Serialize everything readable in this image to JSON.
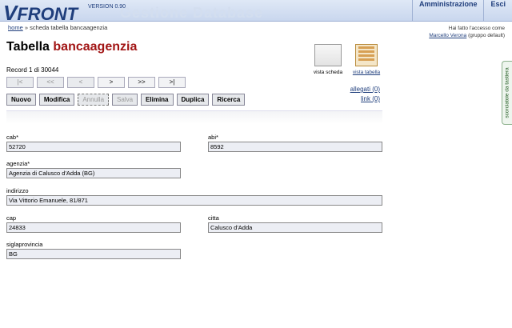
{
  "header": {
    "logo_v": "V",
    "logo_rest": "FRONT",
    "version": "VERSION 0.90",
    "ghost": "Gestione Database",
    "nav": [
      "Amministrazione",
      "Esci"
    ]
  },
  "breadcrumb": {
    "home": "home",
    "rest": "» scheda tabella bancaagenzia"
  },
  "login": {
    "line1": "Hai fatto l'accesso come",
    "user": "Marcello Verona",
    "group": "(gruppo default)"
  },
  "title": {
    "prefix": "Tabella",
    "table": "bancaagenzia"
  },
  "record": "Record 1 di 30044",
  "nav_buttons": [
    "|<",
    "<<",
    "<",
    ">",
    ">>",
    ">|"
  ],
  "action_buttons": [
    "Nuovo",
    "Modifica",
    "Annulla",
    "Salva",
    "Elimina",
    "Duplica",
    "Ricerca"
  ],
  "views": {
    "scheda": "vista scheda",
    "tabella": "vista tabella"
  },
  "links": {
    "allegati": "allegati (0)",
    "link": "link (0)"
  },
  "side_tab": "scorciatoie da tastiera",
  "fields": {
    "cab": {
      "label": "cab*",
      "value": "52720"
    },
    "abi": {
      "label": "abi*",
      "value": "8592"
    },
    "agenzia": {
      "label": "agenzia*",
      "value": "Agenzia di Calusco d'Adda (BG)"
    },
    "indirizzo": {
      "label": "indirizzo",
      "value": "Via Vittorio Emanuele, 81/871"
    },
    "cap": {
      "label": "cap",
      "value": "24833"
    },
    "citta": {
      "label": "citta",
      "value": "Calusco d'Adda"
    },
    "siglaprovincia": {
      "label": "siglaprovincia",
      "value": "BG"
    }
  }
}
